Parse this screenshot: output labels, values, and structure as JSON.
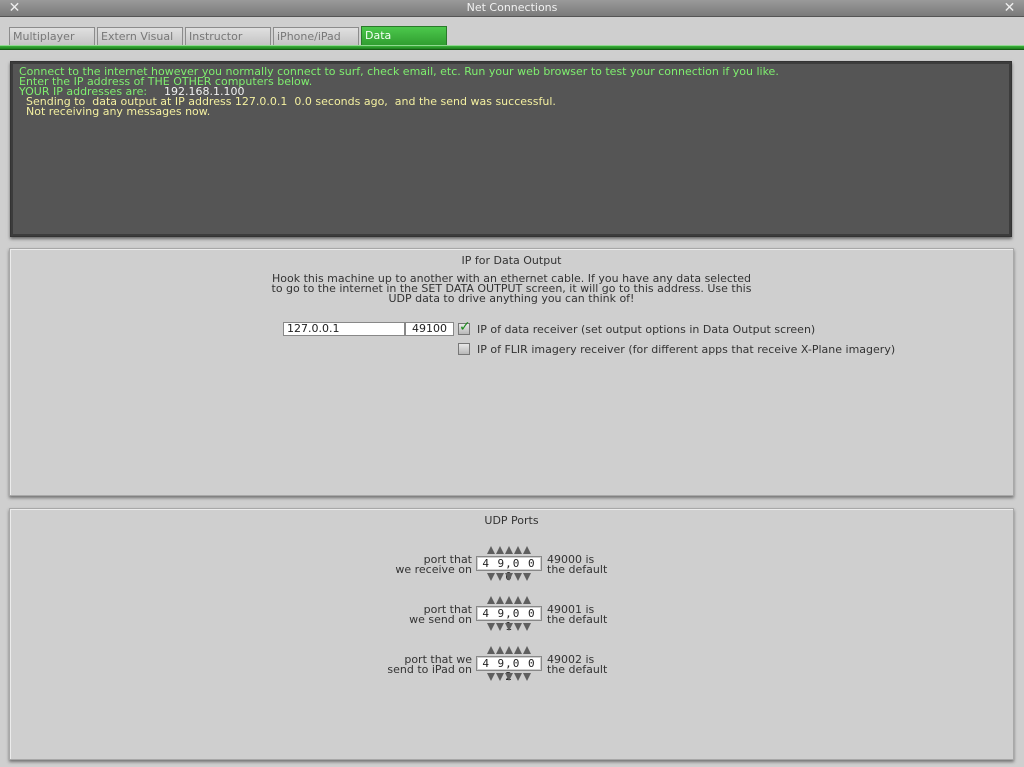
{
  "window": {
    "title": "Net Connections",
    "close_icon": "close-icon"
  },
  "tabs": [
    {
      "label": "Multiplayer",
      "active": false
    },
    {
      "label": "Extern Visual",
      "active": false
    },
    {
      "label": "Instructor",
      "active": false
    },
    {
      "label": "iPhone/iPad",
      "active": false
    },
    {
      "label": "Data",
      "active": true
    }
  ],
  "colors": {
    "active_tab": "#3aaa3a",
    "console_bg": "#555555",
    "console_green": "#7fef6f",
    "console_yellow": "#f4f0a0"
  },
  "console": {
    "line1": "Connect to the internet however you normally connect to surf, check email, etc. Run your web browser to test your connection if you like.",
    "line2": "Enter the IP address of THE OTHER computers below.",
    "line3_label": "YOUR IP addresses are:",
    "line3_value": "192.168.1.100",
    "line4": "  Sending to  data output at IP address 127.0.0.1  0.0 seconds ago,  and the send was successful.",
    "line5": "  Not receiving any messages now."
  },
  "ip_panel": {
    "title": "IP for Data Output",
    "desc1": "Hook this machine up to another with an ethernet cable. If you have any data selected",
    "desc2": "to go to the internet in the SET DATA OUTPUT screen, it will go to this address. Use this",
    "desc3": "UDP data to drive anything you can think of!",
    "ip_value": "127.0.0.1",
    "port_value": "49100",
    "receiver_checked": true,
    "receiver_label": "IP of data receiver (set output options in Data Output screen)",
    "flir_checked": false,
    "flir_label": "IP of FLIR imagery receiver (for different apps that receive X-Plane imagery)"
  },
  "udp_panel": {
    "title": "UDP Ports",
    "ports": [
      {
        "label1": "port that",
        "label2": "we receive on",
        "value": "4 9,0 0 0",
        "note1": "49000 is",
        "note2": "the default"
      },
      {
        "label1": "port that",
        "label2": "we send on",
        "value": "4 9,0 0 1",
        "note1": "49001 is",
        "note2": "the default"
      },
      {
        "label1": "port that we",
        "label2": "send to iPad on",
        "value": "4 9,0 0 2",
        "note1": "49002 is",
        "note2": "the default"
      }
    ]
  }
}
